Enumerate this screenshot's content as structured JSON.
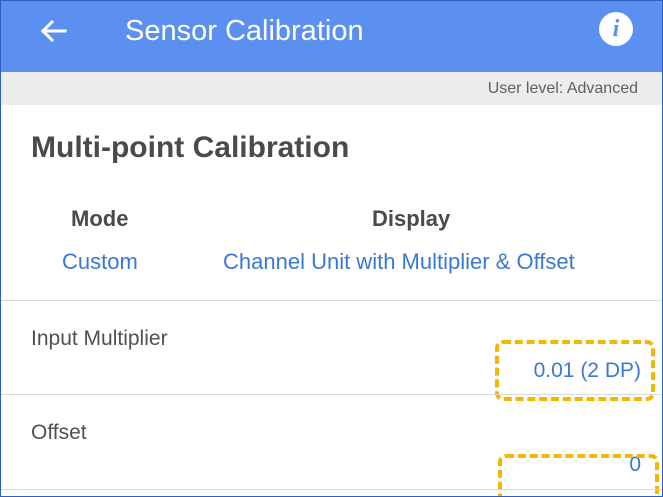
{
  "header": {
    "back_icon": "arrow-left-icon",
    "title": "Sensor Calibration",
    "info_icon": "info-icon",
    "info_glyph": "i",
    "accent_color": "#5b8ff0"
  },
  "user_level": "User level: Advanced",
  "section": {
    "title": "Multi-point Calibration"
  },
  "summary": {
    "mode_label": "Mode",
    "mode_value": "Custom",
    "display_label": "Display",
    "display_value": "Channel Unit with Multiplier & Offset"
  },
  "rows": [
    {
      "label": "Input Multiplier",
      "value": "0.01 (2 DP)"
    },
    {
      "label": "Offset",
      "value": "0"
    }
  ],
  "highlight_color": "#f2b705",
  "link_color": "#3a78d6"
}
